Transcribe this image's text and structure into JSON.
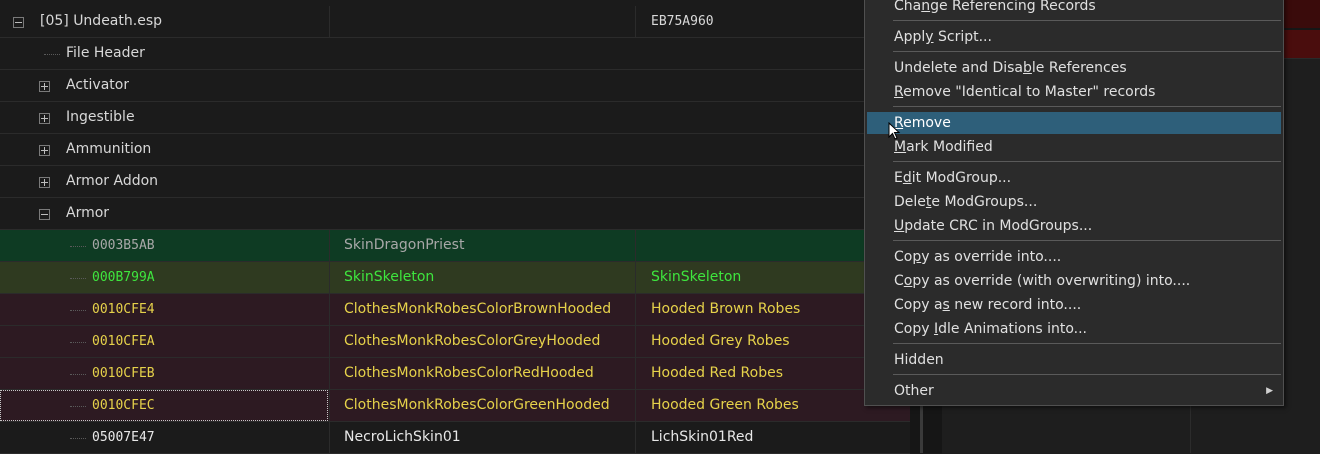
{
  "tree": {
    "rows": [
      {
        "name": "[05] Undeath.esp",
        "col3": "EB75A960"
      },
      {
        "name": "File Header"
      },
      {
        "name": "Activator"
      },
      {
        "name": "Ingestible"
      },
      {
        "name": "Ammunition"
      },
      {
        "name": "Armor Addon"
      },
      {
        "name": "Armor"
      },
      {
        "formid": "0003B5AB",
        "editor_id": "SkinDragonPriest",
        "full_name": ""
      },
      {
        "formid": "000B799A",
        "editor_id": "SkinSkeleton",
        "full_name": "SkinSkeleton"
      },
      {
        "formid": "0010CFE4",
        "editor_id": "ClothesMonkRobesColorBrownHooded",
        "full_name": "Hooded Brown Robes"
      },
      {
        "formid": "0010CFEA",
        "editor_id": "ClothesMonkRobesColorGreyHooded",
        "full_name": "Hooded Grey Robes"
      },
      {
        "formid": "0010CFEB",
        "editor_id": "ClothesMonkRobesColorRedHooded",
        "full_name": "Hooded Red Robes"
      },
      {
        "formid": "0010CFEC",
        "editor_id": "ClothesMonkRobesColorGreenHooded",
        "full_name": "Hooded Green Robes"
      },
      {
        "formid": "05007E47",
        "editor_id": "NecroLichSkin01",
        "full_name": "LichSkin01Red"
      }
    ]
  },
  "context_menu": {
    "items": [
      {
        "pre": "Cha",
        "u": "n",
        "post": "ge Referencing Records"
      },
      {
        "pre": "Appl",
        "u": "y",
        "post": " Script..."
      },
      {
        "pre": "Undelete and Disa",
        "u": "b",
        "post": "le References"
      },
      {
        "pre": "",
        "u": "R",
        "post": "emove \"Identical to Master\" records"
      },
      {
        "pre": "",
        "u": "R",
        "post": "emove"
      },
      {
        "pre": "",
        "u": "M",
        "post": "ark Modified"
      },
      {
        "pre": "E",
        "u": "d",
        "post": "it ModGroup..."
      },
      {
        "pre": "Dele",
        "u": "t",
        "post": "e ModGroups..."
      },
      {
        "pre": "",
        "u": "U",
        "post": "pdate CRC in ModGroups..."
      },
      {
        "pre": "Co",
        "u": "p",
        "post": "y as override into...."
      },
      {
        "pre": "C",
        "u": "o",
        "post": "py as override (with overwriting) into...."
      },
      {
        "pre": "Copy a",
        "u": "s",
        "post": " new record into...."
      },
      {
        "pre": "Copy ",
        "u": "I",
        "post": "dle Animations into..."
      },
      {
        "pre": "",
        "u": "",
        "post": "Hidden"
      },
      {
        "pre": "",
        "u": "",
        "post": "Other"
      }
    ]
  },
  "colors": {
    "menu_highlight": "#2e5f7a",
    "row_green": "#0e3b23",
    "row_olive": "#2f3a20",
    "row_maroon": "#2d1a22",
    "text_green": "#3ee63e",
    "text_yellow": "#e6d24a"
  }
}
